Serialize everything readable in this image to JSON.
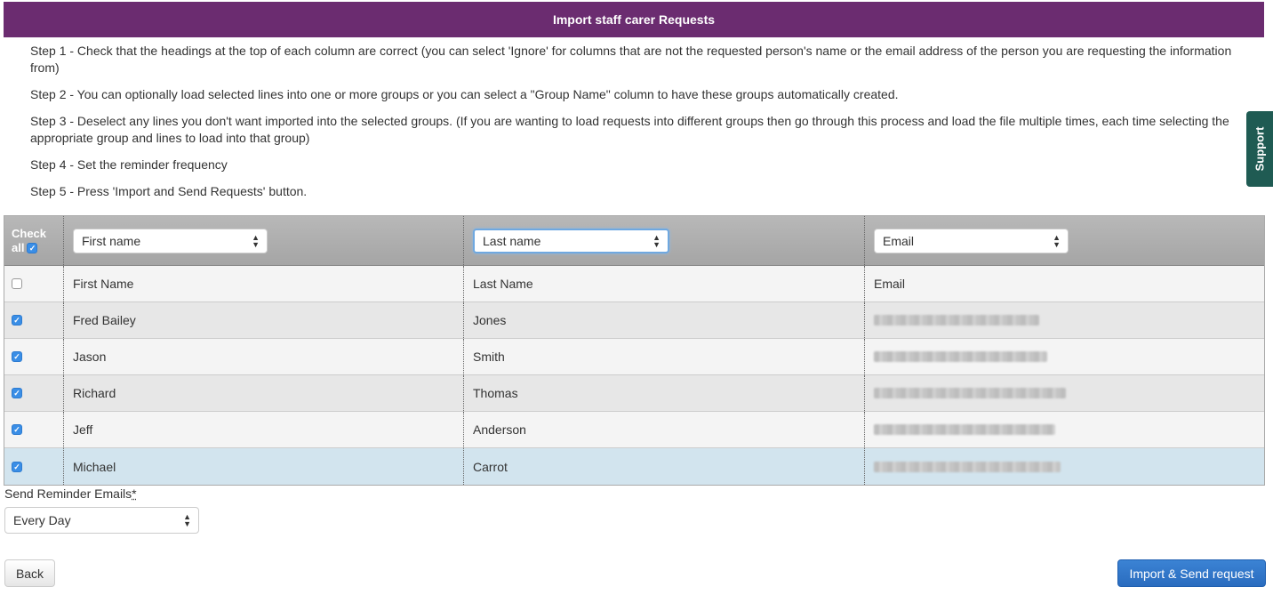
{
  "title": "Import staff carer Requests",
  "steps": [
    "Step 1 - Check that the headings at the top of each column are correct (you can select 'Ignore' for columns that are not the requested person's name or the email address of the person you are requesting the information from)",
    "Step 2 - You can optionally load selected lines into one or more groups or you can select a \"Group Name\" column to have these groups automatically created.",
    "Step 3 - Deselect any lines you don't want imported into the selected groups. (If you are wanting to load requests into different groups then go through this process and load the file multiple times, each time selecting the appropriate group and lines to load into that group)",
    "Step 4 - Set the reminder frequency",
    "Step 5 - Press 'Import and Send Requests' button."
  ],
  "support_label": "Support",
  "grid": {
    "check_all": {
      "line1": "Check",
      "line2": "all",
      "checked": true
    },
    "column_selects": [
      "First name",
      "Last name",
      "Email"
    ],
    "rows": [
      {
        "checked": false,
        "first": "First Name",
        "last": "Last Name",
        "email": "Email"
      },
      {
        "checked": true,
        "first": "Fred Bailey",
        "last": "Jones"
      },
      {
        "checked": true,
        "first": "Jason",
        "last": "Smith"
      },
      {
        "checked": true,
        "first": "Richard",
        "last": "Thomas"
      },
      {
        "checked": true,
        "first": "Jeff",
        "last": "Anderson"
      },
      {
        "checked": true,
        "first": "Michael",
        "last": "Carrot"
      }
    ]
  },
  "reminder": {
    "label": "Send Reminder Emails",
    "required_mark": "*",
    "value": "Every Day"
  },
  "buttons": {
    "back": "Back",
    "import": "Import & Send request"
  },
  "colors": {
    "title_bar": "#6b2c70",
    "support_tab": "#1f5b53",
    "primary_button": "#2a6cbf",
    "selected_row": "#d2e4ee"
  }
}
